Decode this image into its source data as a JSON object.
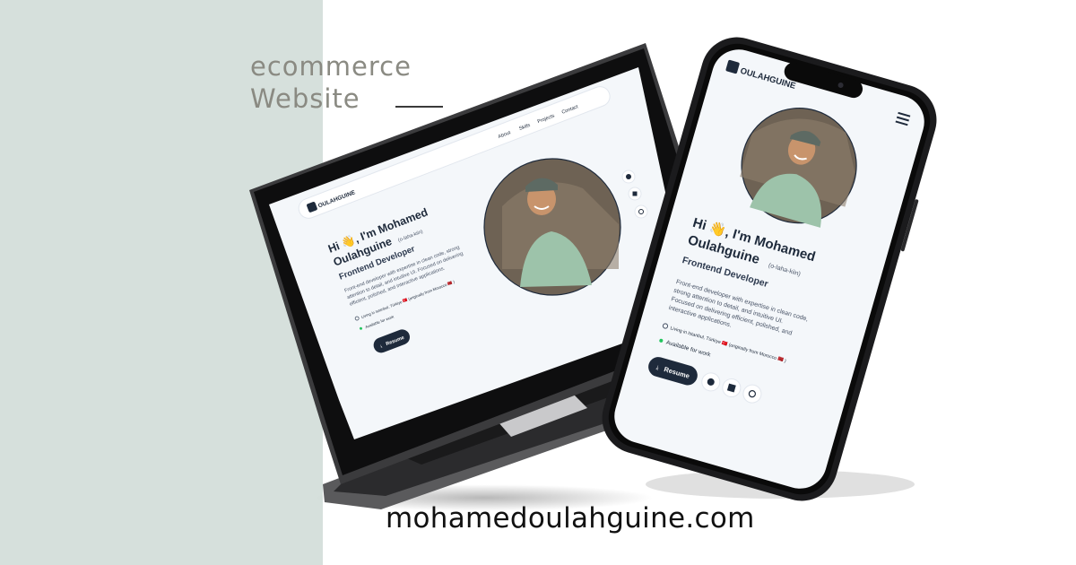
{
  "tagline": {
    "line1": "ecommerce",
    "line2": "Website"
  },
  "site_url": "mohamedoulahguine.com",
  "laptop_site": {
    "logo_text": "OULAHGUINE",
    "nav": [
      "About",
      "Skills",
      "Projects",
      "Contact"
    ],
    "greeting": "Hi 👋, I'm Mohamed",
    "surname": "Oulahguine",
    "pronunciation": "(o-laha-kiin)",
    "role": "Frontend Developer",
    "bio_lines": [
      "Front-end developer with expertise in clean code, strong",
      "attention to detail, and intuitive UI. Focused on delivering",
      "efficient, polished, and interactive applications."
    ],
    "location": "Living in Istanbul, Türkiye 🇹🇷 (originally from Morocco 🇲🇦 )",
    "availability": "Available for work",
    "resume_label": "Resume"
  },
  "phone_site": {
    "logo_text": "OULAHGUINE",
    "greeting": "Hi 👋, I'm Mohamed",
    "surname": "Oulahguine",
    "pronunciation": "(o-laha-kiin)",
    "role": "Frontend Developer",
    "bio_lines": [
      "Front-end developer with expertise in clean code,",
      "strong attention to detail, and intuitive UI.",
      "Focused on delivering efficient, polished, and",
      "interactive applications."
    ],
    "location": "Living in Istanbul, Türkiye 🇹🇷 (originally from Morocco 🇲🇦 )",
    "availability": "Available for work",
    "resume_label": "Resume"
  },
  "colors": {
    "panel": "#d6e0dc",
    "navy": "#1e2a3b",
    "status": "#22c55e"
  },
  "icons": [
    "github-icon",
    "linkedin-icon",
    "menu-icon",
    "location-pin-icon",
    "download-icon"
  ]
}
